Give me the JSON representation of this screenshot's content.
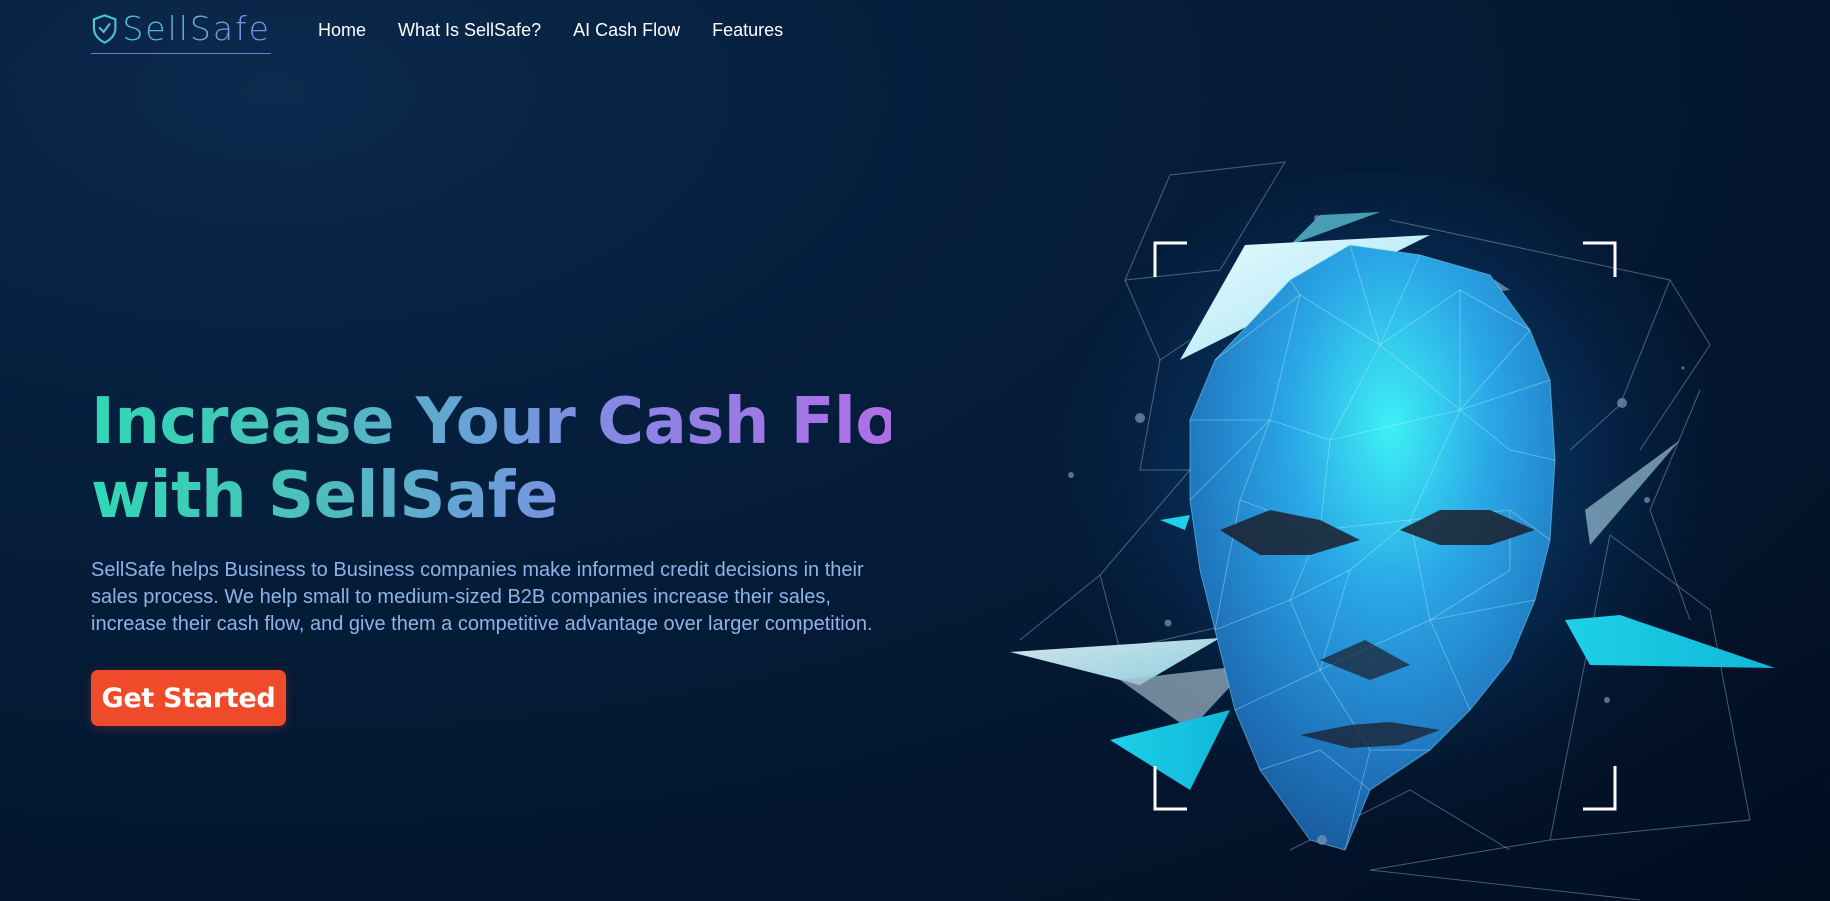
{
  "brand": {
    "name": "SellSafe",
    "logo_icon": "shield-check-icon",
    "colors": {
      "teal": "#2fd8b6",
      "purple": "#b06ee6",
      "cta": "#ef4a2a",
      "bg": "#041a35"
    }
  },
  "nav": {
    "items": [
      {
        "label": "Home"
      },
      {
        "label": "What Is SellSafe?"
      },
      {
        "label": "AI Cash Flow"
      },
      {
        "label": "Features"
      }
    ]
  },
  "hero": {
    "headline_line1": "Increase Your Cash Flow",
    "headline_line2": "with SellSafe",
    "description": "SellSafe helps Business to Business companies make informed credit decisions in their sales process. We help small to medium-sized B2B companies increase their sales, increase their cash flow, and give them a competitive advantage over larger competition.",
    "cta_label": "Get Started"
  },
  "illustration": {
    "icon": "polygon-face-scan-icon"
  }
}
